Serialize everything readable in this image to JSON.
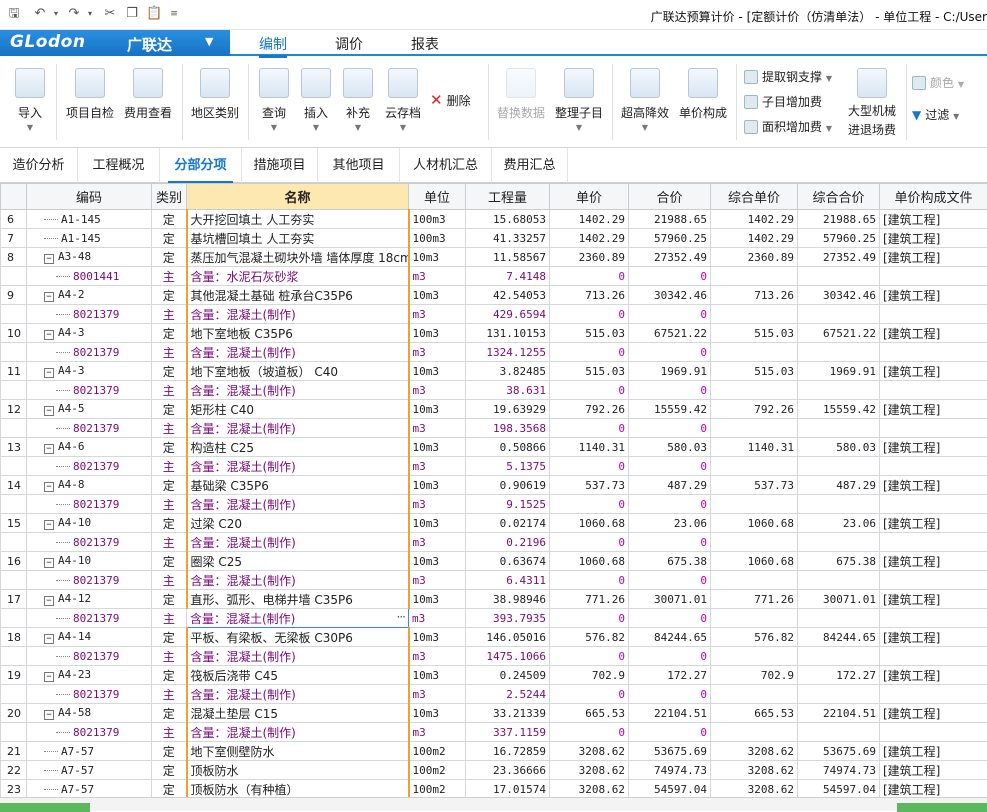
{
  "app": {
    "title": "广联达预算计价 - [定额计价（仿清单法） - 单位工程 - C:/User"
  },
  "logo": {
    "text": "GLodon",
    "cn": "广联达"
  },
  "ribbon_tabs": [
    "编制",
    "调价",
    "报表"
  ],
  "ribbon": {
    "import": "导入",
    "project_check": "项目自检",
    "fee_query": "费用查看",
    "region_category": "地区类别",
    "query": "查询",
    "insert": "插入",
    "supplement": "补充",
    "cloud_save": "云存档",
    "delete": "删除",
    "replace_data": "替换数据",
    "organize_sub": "整理子目",
    "super_high_drop": "超高降效",
    "unit_composition": "单价构成",
    "extract_rebar": "提取钢支撑",
    "sub_increase": "子目增加费",
    "area_increase": "面积增加费",
    "large_machine_line1": "大型机械",
    "large_machine_line2": "进退场费",
    "color": "颜色",
    "filter": "过滤"
  },
  "section_tabs": [
    "造价分析",
    "工程概况",
    "分部分项",
    "措施项目",
    "其他项目",
    "人材机汇总",
    "费用汇总"
  ],
  "table": {
    "columns": [
      "编码",
      "类别",
      "名称",
      "单位",
      "工程量",
      "单价",
      "合价",
      "综合单价",
      "综合合价",
      "单价构成文件"
    ],
    "rows": [
      {
        "idx": "6",
        "code": "A1-145",
        "cat": "定",
        "name": "大开挖回填土 人工夯实",
        "unit": "100m3",
        "qty": "15.68053",
        "price": "1402.29",
        "total": "21988.65",
        "comp_price": "1402.29",
        "comp_total": "21988.65",
        "file": "[建筑工程]",
        "type": "main",
        "expand": false
      },
      {
        "idx": "7",
        "code": "A1-145",
        "cat": "定",
        "name": "基坑槽回填土 人工夯实",
        "unit": "100m3",
        "qty": "41.33257",
        "price": "1402.29",
        "total": "57960.25",
        "comp_price": "1402.29",
        "comp_total": "57960.25",
        "file": "[建筑工程]",
        "type": "main",
        "expand": false
      },
      {
        "idx": "8",
        "code": "A3-48",
        "cat": "定",
        "name": "蒸压加气混凝土砌块外墙 墙体厚度 18cm",
        "unit": "10m3",
        "qty": "11.58567",
        "price": "2360.89",
        "total": "27352.49",
        "comp_price": "2360.89",
        "comp_total": "27352.49",
        "file": "[建筑工程]",
        "type": "main",
        "expand": true
      },
      {
        "idx": "",
        "code": "8001441",
        "cat": "主",
        "name": "含量：水泥石灰砂浆",
        "unit": "m3",
        "qty": "7.4148",
        "price": "0",
        "total": "0",
        "comp_price": "",
        "comp_total": "",
        "file": "",
        "type": "sub"
      },
      {
        "idx": "9",
        "code": "A4-2",
        "cat": "定",
        "name": "其他混凝土基础 桩承台C35P6",
        "unit": "10m3",
        "qty": "42.54053",
        "price": "713.26",
        "total": "30342.46",
        "comp_price": "713.26",
        "comp_total": "30342.46",
        "file": "[建筑工程]",
        "type": "main",
        "expand": true
      },
      {
        "idx": "",
        "code": "8021379",
        "cat": "主",
        "name": "含量：混凝土(制作)",
        "unit": "m3",
        "qty": "429.6594",
        "price": "0",
        "total": "0",
        "comp_price": "",
        "comp_total": "",
        "file": "",
        "type": "sub"
      },
      {
        "idx": "10",
        "code": "A4-3",
        "cat": "定",
        "name": "地下室地板 C35P6",
        "unit": "10m3",
        "qty": "131.10153",
        "price": "515.03",
        "total": "67521.22",
        "comp_price": "515.03",
        "comp_total": "67521.22",
        "file": "[建筑工程]",
        "type": "main",
        "expand": true
      },
      {
        "idx": "",
        "code": "8021379",
        "cat": "主",
        "name": "含量：混凝土(制作)",
        "unit": "m3",
        "qty": "1324.1255",
        "price": "0",
        "total": "0",
        "comp_price": "",
        "comp_total": "",
        "file": "",
        "type": "sub"
      },
      {
        "idx": "11",
        "code": "A4-3",
        "cat": "定",
        "name": "地下室地板（坡道板） C40",
        "unit": "10m3",
        "qty": "3.82485",
        "price": "515.03",
        "total": "1969.91",
        "comp_price": "515.03",
        "comp_total": "1969.91",
        "file": "[建筑工程]",
        "type": "main",
        "expand": true
      },
      {
        "idx": "",
        "code": "8021379",
        "cat": "主",
        "name": "含量：混凝土(制作)",
        "unit": "m3",
        "qty": "38.631",
        "price": "0",
        "total": "0",
        "comp_price": "",
        "comp_total": "",
        "file": "",
        "type": "sub"
      },
      {
        "idx": "12",
        "code": "A4-5",
        "cat": "定",
        "name": "矩形柱 C40",
        "unit": "10m3",
        "qty": "19.63929",
        "price": "792.26",
        "total": "15559.42",
        "comp_price": "792.26",
        "comp_total": "15559.42",
        "file": "[建筑工程]",
        "type": "main",
        "expand": true
      },
      {
        "idx": "",
        "code": "8021379",
        "cat": "主",
        "name": "含量：混凝土(制作)",
        "unit": "m3",
        "qty": "198.3568",
        "price": "0",
        "total": "0",
        "comp_price": "",
        "comp_total": "",
        "file": "",
        "type": "sub"
      },
      {
        "idx": "13",
        "code": "A4-6",
        "cat": "定",
        "name": "构造柱 C25",
        "unit": "10m3",
        "qty": "0.50866",
        "price": "1140.31",
        "total": "580.03",
        "comp_price": "1140.31",
        "comp_total": "580.03",
        "file": "[建筑工程]",
        "type": "main",
        "expand": true
      },
      {
        "idx": "",
        "code": "8021379",
        "cat": "主",
        "name": "含量：混凝土(制作)",
        "unit": "m3",
        "qty": "5.1375",
        "price": "0",
        "total": "0",
        "comp_price": "",
        "comp_total": "",
        "file": "",
        "type": "sub"
      },
      {
        "idx": "14",
        "code": "A4-8",
        "cat": "定",
        "name": "基础梁 C35P6",
        "unit": "10m3",
        "qty": "0.90619",
        "price": "537.73",
        "total": "487.29",
        "comp_price": "537.73",
        "comp_total": "487.29",
        "file": "[建筑工程]",
        "type": "main",
        "expand": true
      },
      {
        "idx": "",
        "code": "8021379",
        "cat": "主",
        "name": "含量：混凝土(制作)",
        "unit": "m3",
        "qty": "9.1525",
        "price": "0",
        "total": "0",
        "comp_price": "",
        "comp_total": "",
        "file": "",
        "type": "sub"
      },
      {
        "idx": "15",
        "code": "A4-10",
        "cat": "定",
        "name": "过梁 C20",
        "unit": "10m3",
        "qty": "0.02174",
        "price": "1060.68",
        "total": "23.06",
        "comp_price": "1060.68",
        "comp_total": "23.06",
        "file": "[建筑工程]",
        "type": "main",
        "expand": true
      },
      {
        "idx": "",
        "code": "8021379",
        "cat": "主",
        "name": "含量：混凝土(制作)",
        "unit": "m3",
        "qty": "0.2196",
        "price": "0",
        "total": "0",
        "comp_price": "",
        "comp_total": "",
        "file": "",
        "type": "sub"
      },
      {
        "idx": "16",
        "code": "A4-10",
        "cat": "定",
        "name": "圈梁 C25",
        "unit": "10m3",
        "qty": "0.63674",
        "price": "1060.68",
        "total": "675.38",
        "comp_price": "1060.68",
        "comp_total": "675.38",
        "file": "[建筑工程]",
        "type": "main",
        "expand": true
      },
      {
        "idx": "",
        "code": "8021379",
        "cat": "主",
        "name": "含量：混凝土(制作)",
        "unit": "m3",
        "qty": "6.4311",
        "price": "0",
        "total": "0",
        "comp_price": "",
        "comp_total": "",
        "file": "",
        "type": "sub"
      },
      {
        "idx": "17",
        "code": "A4-12",
        "cat": "定",
        "name": "直形、弧形、电梯井墙 C35P6",
        "unit": "10m3",
        "qty": "38.98946",
        "price": "771.26",
        "total": "30071.01",
        "comp_price": "771.26",
        "comp_total": "30071.01",
        "file": "[建筑工程]",
        "type": "main",
        "expand": true
      },
      {
        "idx": "",
        "code": "8021379",
        "cat": "主",
        "name": "含量：混凝土(制作)",
        "unit": "m3",
        "qty": "393.7935",
        "price": "0",
        "total": "0",
        "comp_price": "",
        "comp_total": "",
        "file": "",
        "type": "sub",
        "focus": true
      },
      {
        "idx": "18",
        "code": "A4-14",
        "cat": "定",
        "name": "平板、有梁板、无梁板 C30P6",
        "unit": "10m3",
        "qty": "146.05016",
        "price": "576.82",
        "total": "84244.65",
        "comp_price": "576.82",
        "comp_total": "84244.65",
        "file": "[建筑工程]",
        "type": "main",
        "expand": true
      },
      {
        "idx": "",
        "code": "8021379",
        "cat": "主",
        "name": "含量：混凝土(制作)",
        "unit": "m3",
        "qty": "1475.1066",
        "price": "0",
        "total": "0",
        "comp_price": "",
        "comp_total": "",
        "file": "",
        "type": "sub"
      },
      {
        "idx": "19",
        "code": "A4-23",
        "cat": "定",
        "name": "筏板后浇带 C45",
        "unit": "10m3",
        "qty": "0.24509",
        "price": "702.9",
        "total": "172.27",
        "comp_price": "702.9",
        "comp_total": "172.27",
        "file": "[建筑工程]",
        "type": "main",
        "expand": true
      },
      {
        "idx": "",
        "code": "8021379",
        "cat": "主",
        "name": "含量：混凝土(制作)",
        "unit": "m3",
        "qty": "2.5244",
        "price": "0",
        "total": "0",
        "comp_price": "",
        "comp_total": "",
        "file": "",
        "type": "sub"
      },
      {
        "idx": "20",
        "code": "A4-58",
        "cat": "定",
        "name": "混凝土垫层 C15",
        "unit": "10m3",
        "qty": "33.21339",
        "price": "665.53",
        "total": "22104.51",
        "comp_price": "665.53",
        "comp_total": "22104.51",
        "file": "[建筑工程]",
        "type": "main",
        "expand": true
      },
      {
        "idx": "",
        "code": "8021379",
        "cat": "主",
        "name": "含量：混凝土(制作)",
        "unit": "m3",
        "qty": "337.1159",
        "price": "0",
        "total": "0",
        "comp_price": "",
        "comp_total": "",
        "file": "",
        "type": "sub"
      },
      {
        "idx": "21",
        "code": "A7-57",
        "cat": "定",
        "name": "地下室侧壁防水",
        "unit": "100m2",
        "qty": "16.72859",
        "price": "3208.62",
        "total": "53675.69",
        "comp_price": "3208.62",
        "comp_total": "53675.69",
        "file": "[建筑工程]",
        "type": "main",
        "expand": false
      },
      {
        "idx": "22",
        "code": "A7-57",
        "cat": "定",
        "name": "顶板防水",
        "unit": "100m2",
        "qty": "23.36666",
        "price": "3208.62",
        "total": "74974.73",
        "comp_price": "3208.62",
        "comp_total": "74974.73",
        "file": "[建筑工程]",
        "type": "main",
        "expand": false
      },
      {
        "idx": "23",
        "code": "A7-57",
        "cat": "定",
        "name": "顶板防水（有种植）",
        "unit": "100m2",
        "qty": "17.01574",
        "price": "3208.62",
        "total": "54597.04",
        "comp_price": "3208.62",
        "comp_total": "54597.04",
        "file": "[建筑工程]",
        "type": "main",
        "expand": false
      }
    ]
  },
  "colors": {
    "accent": "#1677d2",
    "sub_row_text": "#7a0a7a",
    "header_selected": "#fde9b0"
  }
}
